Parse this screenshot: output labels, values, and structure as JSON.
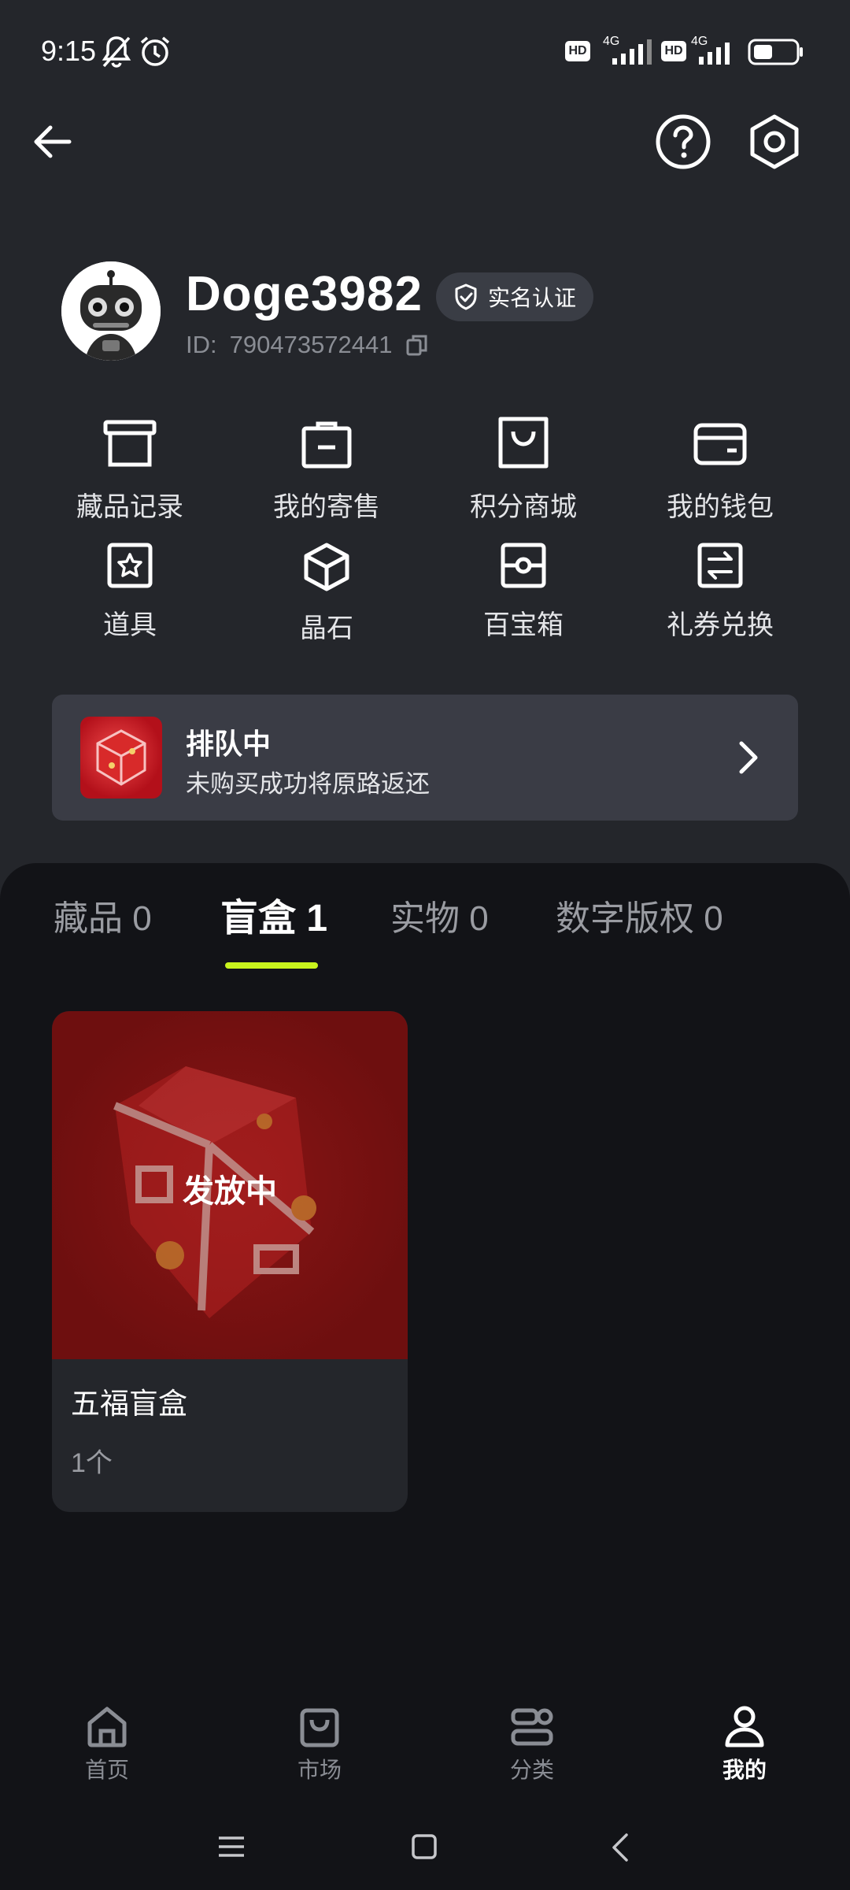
{
  "status_bar": {
    "time": "9:15",
    "network_labels": [
      "HD",
      "4G",
      "HD",
      "4G"
    ],
    "battery_level": 0.45
  },
  "header": {
    "back_icon": "arrow-left-icon",
    "help_icon": "question-circle-icon",
    "settings_icon": "hexagon-gear-icon"
  },
  "profile": {
    "username": "Doge3982",
    "verify_label": "实名认证",
    "id_label": "ID:",
    "id_value": "790473572441"
  },
  "menu": {
    "row1": [
      {
        "label": "藏品记录",
        "icon": "archive-box-icon"
      },
      {
        "label": "我的寄售",
        "icon": "shopping-bag-icon"
      },
      {
        "label": "积分商城",
        "icon": "store-bag-icon"
      },
      {
        "label": "我的钱包",
        "icon": "wallet-icon"
      }
    ],
    "row2": [
      {
        "label": "道具",
        "icon": "star-box-icon"
      },
      {
        "label": "晶石",
        "icon": "cube-icon"
      },
      {
        "label": "百宝箱",
        "icon": "treasure-box-icon"
      },
      {
        "label": "礼券兑换",
        "icon": "exchange-icon"
      }
    ]
  },
  "queue": {
    "title": "排队中",
    "subtitle": "未购买成功将原路返还"
  },
  "tabs": [
    {
      "label": "藏品 0",
      "active": false
    },
    {
      "label": "盲盒 1",
      "active": true
    },
    {
      "label": "实物 0",
      "active": false
    },
    {
      "label": "数字版权 0",
      "active": false
    }
  ],
  "items": [
    {
      "status": "发放中",
      "name": "五福盲盒",
      "count": "1个"
    }
  ],
  "bottom_nav": [
    {
      "label": "首页",
      "icon": "home-icon",
      "active": false
    },
    {
      "label": "市场",
      "icon": "shopping-bag-icon",
      "active": false
    },
    {
      "label": "分类",
      "icon": "category-icon",
      "active": false
    },
    {
      "label": "我的",
      "icon": "user-icon",
      "active": true
    }
  ],
  "colors": {
    "background": "#24262b",
    "lower_background": "#121317",
    "accent": "#c8f31d",
    "card": "#3a3c45"
  }
}
